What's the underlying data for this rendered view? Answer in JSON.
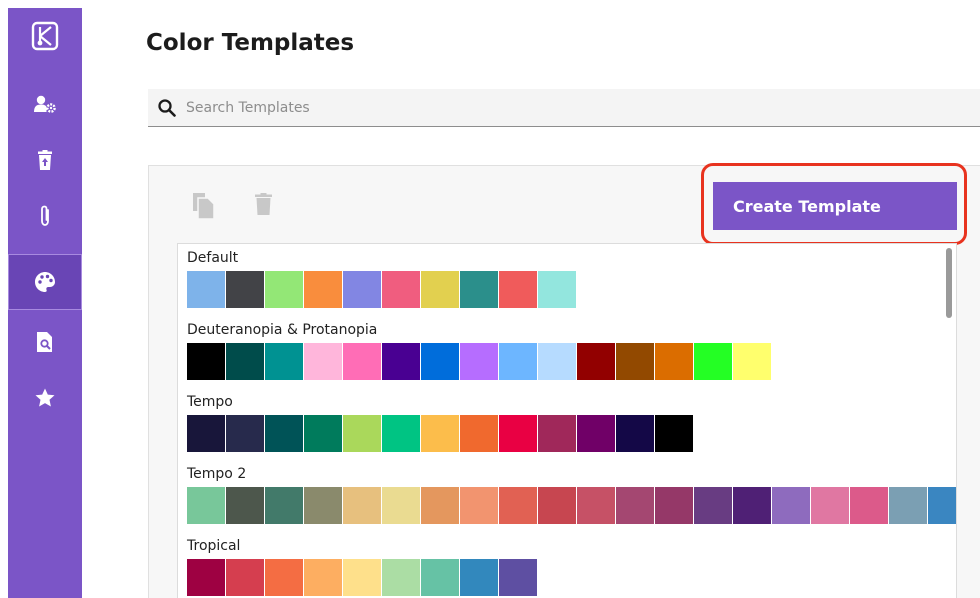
{
  "sidebar": {
    "items": [
      {
        "icon": "app-logo-icon"
      },
      {
        "icon": "user-settings-icon"
      },
      {
        "icon": "trash-restore-icon"
      },
      {
        "icon": "paperclip-icon"
      },
      {
        "icon": "palette-icon",
        "active": true
      },
      {
        "icon": "file-search-icon"
      },
      {
        "icon": "star-icon"
      }
    ]
  },
  "page": {
    "title": "Color Templates"
  },
  "search": {
    "placeholder": "Search Templates",
    "value": ""
  },
  "toolbar": {
    "copy_icon": "copy-icon",
    "delete_icon": "trash-icon",
    "create_label": "Create Template"
  },
  "colors": {
    "accent": "#7b55c7",
    "highlight": "#e8331f"
  },
  "templates": [
    {
      "name": "Default",
      "colors": [
        "#7eb3ea",
        "#424347",
        "#93e776",
        "#f98d3d",
        "#8286e3",
        "#f05d7f",
        "#e2d04f",
        "#2b8f8b",
        "#f05b5b",
        "#93e6de"
      ]
    },
    {
      "name": "Deuteranopia & Protanopia",
      "colors": [
        "#000000",
        "#004c4b",
        "#009292",
        "#ffb6db",
        "#ff6db6",
        "#490092",
        "#006ddb",
        "#b66dff",
        "#6db6ff",
        "#b6dbff",
        "#920000",
        "#924900",
        "#db6d00",
        "#24ff24",
        "#ffff6d"
      ]
    },
    {
      "name": "Tempo",
      "colors": [
        "#18163a",
        "#272a4c",
        "#005357",
        "#007b5c",
        "#aad85b",
        "#00c483",
        "#fcbd4b",
        "#f0692e",
        "#e90043",
        "#a0285a",
        "#700067",
        "#140847",
        "#000000"
      ]
    },
    {
      "name": "Tempo 2",
      "colors": [
        "#78c79a",
        "#4d574c",
        "#427a6a",
        "#8a8a6c",
        "#e7c07e",
        "#eadb91",
        "#e4975e",
        "#f2946f",
        "#e16153",
        "#c74650",
        "#c65166",
        "#a44771",
        "#953868",
        "#683c82",
        "#4f2075",
        "#8e6bbe",
        "#e077a2",
        "#dc5a8a",
        "#7b9fb3",
        "#3a86c1"
      ]
    },
    {
      "name": "Tropical",
      "colors": [
        "#9e0142",
        "#d53e4f",
        "#f46d43",
        "#fdae61",
        "#fee08b",
        "#abdda4",
        "#66c2a5",
        "#3288bd",
        "#5e4fa2"
      ]
    }
  ]
}
